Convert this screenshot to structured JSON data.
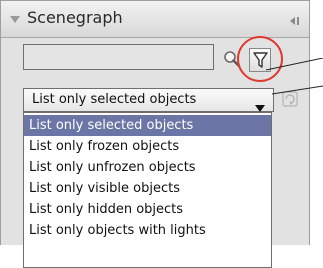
{
  "panel": {
    "title": "Scenegraph",
    "title_arrow_icon": "triangle-down-icon",
    "collapse_icon": "collapse-left-icon"
  },
  "search": {
    "value": "",
    "search_icon": "magnifier-icon",
    "filter_icon": "funnel-filter-icon"
  },
  "filter_select": {
    "value": "List only selected objects",
    "arrow_icon": "triangle-down-icon",
    "side_icon": "refresh-icon"
  },
  "dropdown": {
    "options": [
      "List only selected objects",
      "List only frozen objects",
      "List only unfrozen objects",
      "List only visible objects",
      "List only hidden objects",
      "List only objects with lights"
    ],
    "highlighted_index": 0
  },
  "colors": {
    "highlight_ring": "#e0392f",
    "selected_item_bg": "#6b76a6",
    "panel_bg": "#e2e2e2"
  }
}
